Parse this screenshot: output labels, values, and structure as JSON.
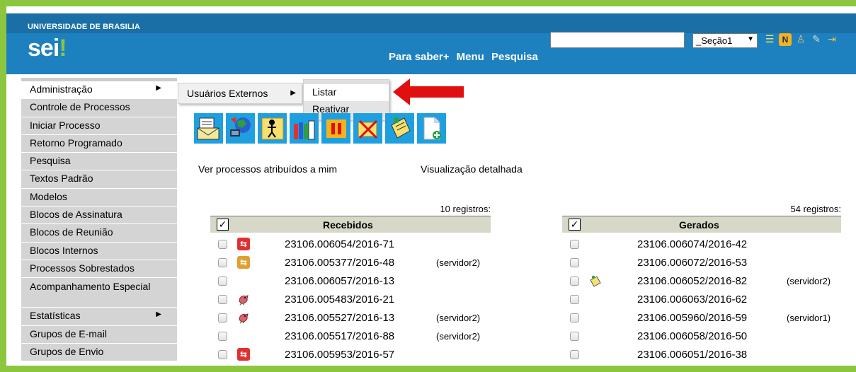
{
  "header": {
    "institution": "UNIVERSIDADE DE BRASILIA",
    "logo_text": "sei",
    "logo_mark": "!",
    "links": [
      "Para saber+",
      "Menu",
      "Pesquisa"
    ],
    "search_value": "",
    "section_select": "_Seção1",
    "icons": [
      "list-icon",
      "n-icon",
      "user-icon",
      "wrench-icon",
      "exit-icon"
    ]
  },
  "sidebar": {
    "items": [
      {
        "label": "Administração",
        "arrow": "▶",
        "active": true
      },
      {
        "label": "Controle de Processos"
      },
      {
        "label": "Iniciar Processo"
      },
      {
        "label": "Retorno Programado"
      },
      {
        "label": "Pesquisa"
      },
      {
        "label": "Textos Padrão"
      },
      {
        "label": "Modelos"
      },
      {
        "label": "Blocos de Assinatura"
      },
      {
        "label": "Blocos de Reunião"
      },
      {
        "label": "Blocos Internos"
      },
      {
        "label": "Processos Sobrestados"
      },
      {
        "label": "Acompanhamento Especial"
      },
      {
        "label": "Estatísticas",
        "arrow": "▶"
      },
      {
        "label": "Grupos de E-mail"
      },
      {
        "label": "Grupos de Envio"
      }
    ]
  },
  "menu": {
    "submenu_label": "Usuários Externos",
    "submenu_arrow": "▶",
    "options": [
      "Listar",
      "Reativar"
    ]
  },
  "links": {
    "assigned": "Ver processos atribuídos a mim",
    "detailed": "Visualização detalhada"
  },
  "received": {
    "count": "10 registros:",
    "title": "Recebidos",
    "check": "✓",
    "rows": [
      {
        "number": "23106.006054/2016-71",
        "icon": "red",
        "glyph": "⇆",
        "user": ""
      },
      {
        "number": "23106.005377/2016-48",
        "icon": "orange",
        "glyph": "⇆",
        "user": "(servidor2)"
      },
      {
        "number": "23106.006057/2016-13",
        "icon": "",
        "glyph": "",
        "user": ""
      },
      {
        "number": "23106.005483/2016-21",
        "icon": "bird",
        "glyph": "",
        "user": ""
      },
      {
        "number": "23106.005527/2016-13",
        "icon": "bird",
        "glyph": "",
        "user": "(servidor2)"
      },
      {
        "number": "23106.005517/2016-88",
        "icon": "",
        "glyph": "",
        "user": "(servidor2)"
      },
      {
        "number": "23106.005953/2016-57",
        "icon": "red",
        "glyph": "⇆",
        "user": ""
      }
    ]
  },
  "generated": {
    "count": "54 registros:",
    "title": "Gerados",
    "check": "✓",
    "rows": [
      {
        "number": "23106.006074/2016-42",
        "icon": "",
        "user": ""
      },
      {
        "number": "23106.006072/2016-53",
        "icon": "",
        "user": ""
      },
      {
        "number": "23106.006052/2016-82",
        "icon": "note",
        "user": "(servidor2)"
      },
      {
        "number": "23106.006063/2016-62",
        "icon": "",
        "user": ""
      },
      {
        "number": "23106.005960/2016-59",
        "icon": "",
        "user": "(servidor1)"
      },
      {
        "number": "23106.006058/2016-50",
        "icon": "",
        "user": ""
      },
      {
        "number": "23106.006051/2016-38",
        "icon": "",
        "user": ""
      }
    ]
  },
  "colors": {
    "frame": "#8cc63f",
    "header": "#1d81bf",
    "toolbar_button": "#1ea0e0",
    "arrow": "#e01010"
  }
}
